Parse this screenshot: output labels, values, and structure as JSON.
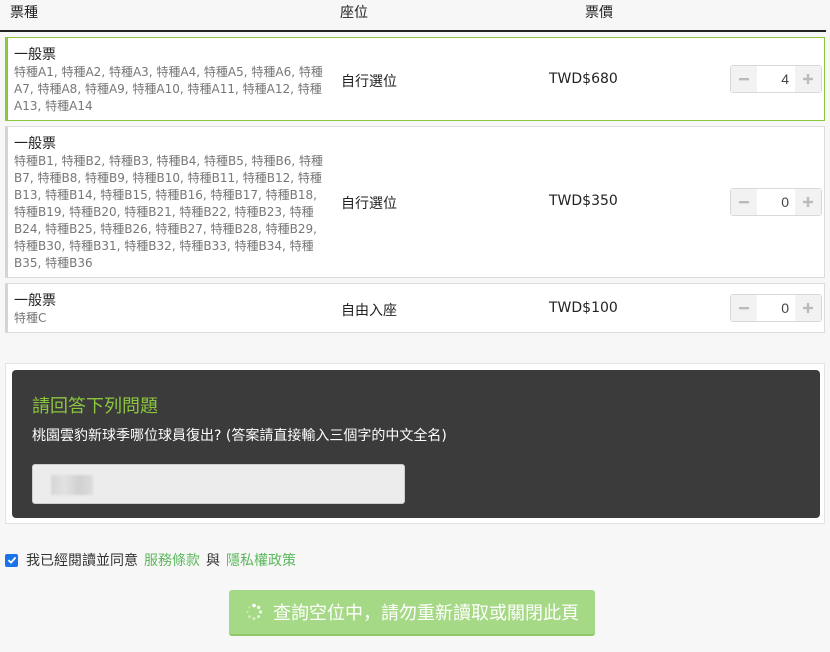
{
  "header": {
    "col_type": "票種",
    "col_seat": "座位",
    "col_price": "票價"
  },
  "tickets": [
    {
      "title": "一般票",
      "desc": "特種A1, 特種A2, 特種A3, 特種A4, 特種A5, 特種A6, 特種A7, 特種A8, 特種A9, 特種A10, 特種A11, 特種A12, 特種A13, 特種A14",
      "seat": "自行選位",
      "price": "TWD$680",
      "qty": "4"
    },
    {
      "title": "一般票",
      "desc": "特種B1, 特種B2, 特種B3, 特種B4, 特種B5, 特種B6, 特種B7, 特種B8, 特種B9, 特種B10, 特種B11, 特種B12, 特種B13, 特種B14, 特種B15, 特種B16, 特種B17, 特種B18, 特種B19, 特種B20, 特種B21, 特種B22, 特種B23, 特種B24, 特種B25, 特種B26, 特種B27, 特種B28, 特種B29, 特種B30, 特種B31, 特種B32, 特種B33, 特種B34, 特種B35, 特種B36",
      "seat": "自行選位",
      "price": "TWD$350",
      "qty": "0"
    },
    {
      "title": "一般票",
      "desc": "特種C",
      "seat": "自由入座",
      "price": "TWD$100",
      "qty": "0"
    }
  ],
  "captcha": {
    "title": "請回答下列問題",
    "question": "桃園雲豹新球季哪位球員復出? (答案請直接輸入三個字的中文全名)"
  },
  "agreement": {
    "prefix": "我已經閱讀並同意",
    "terms_link": "服務條款",
    "and": "與",
    "privacy_link": "隱私權政策",
    "checked": true
  },
  "submit": {
    "label": "查詢空位中，請勿重新讀取或關閉此頁"
  },
  "colors": {
    "accent": "#8cc63f",
    "link": "#5cb85c",
    "button": "#a6d985",
    "captcha_bg": "#3b3b3b"
  }
}
